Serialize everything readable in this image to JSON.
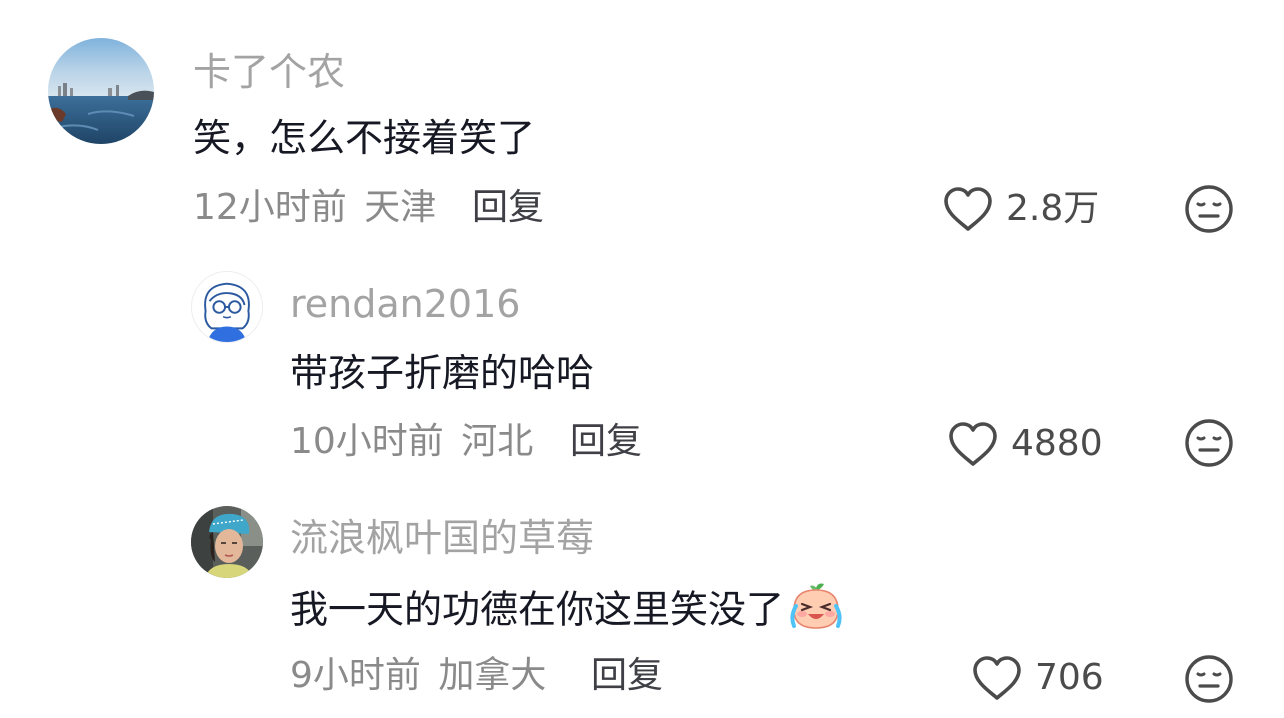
{
  "comments": [
    {
      "username": "卡了个农",
      "text": "笑，怎么不接着笑了",
      "time": "12小时前",
      "location": "天津",
      "reply_label": "回复",
      "likes": "2.8万",
      "avatar_icon": "avatar-seascape"
    },
    {
      "username": "rendan2016",
      "text": "带孩子折磨的哈哈",
      "time": "10小时前",
      "location": "河北",
      "reply_label": "回复",
      "likes": "4880",
      "avatar_icon": "avatar-cartoon-girl"
    },
    {
      "username": "流浪枫叶国的草莓",
      "text": "我一天的功德在你这里笑没了",
      "emoji": "crying-laughing-peach-emoji",
      "time": "9小时前",
      "location": "加拿大",
      "reply_label": "回复",
      "likes": "706",
      "avatar_icon": "avatar-photo-woman"
    }
  ],
  "icons": {
    "like": "heart-outline-icon",
    "dislike": "neutral-face-icon"
  },
  "colors": {
    "username": "#a3a3a3",
    "text": "#161823",
    "meta": "#8a8a8a",
    "icon": "#4b4b4b"
  }
}
